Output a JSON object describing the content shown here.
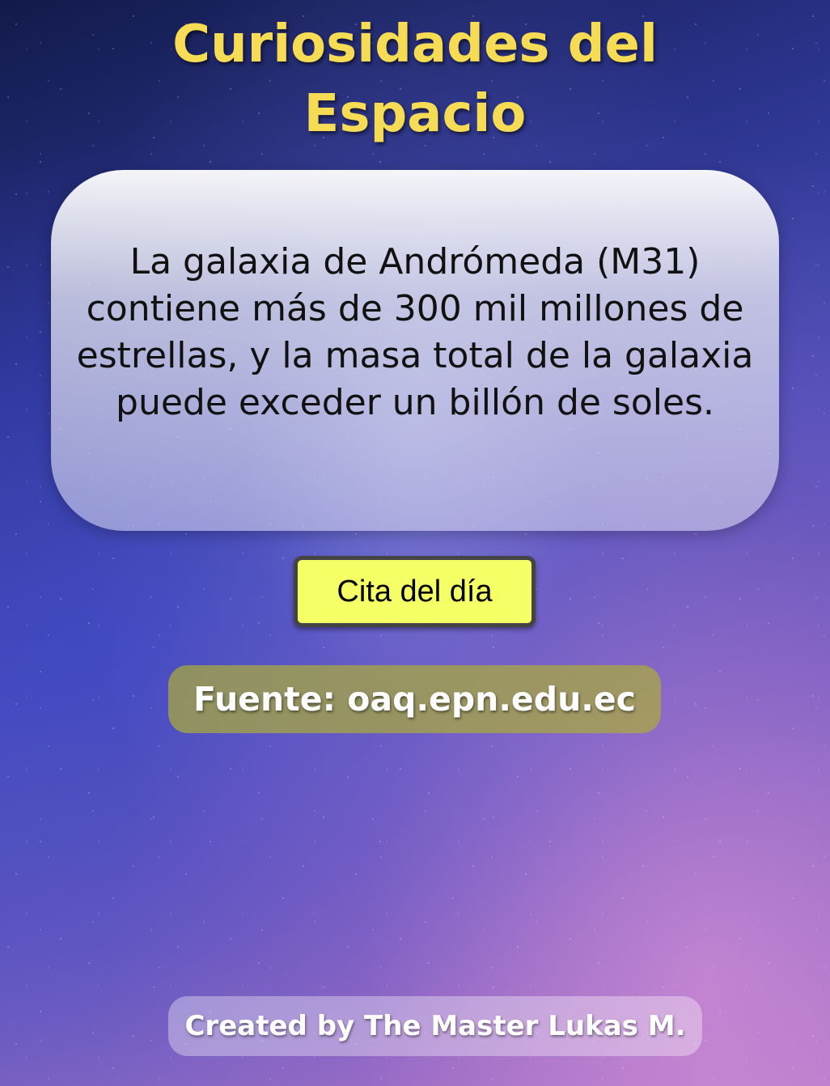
{
  "header": {
    "title_line1": "Curiosidades del",
    "title_line2": "Espacio"
  },
  "fact": {
    "text": "La galaxia de Andrómeda (M31) contiene más de 300 mil millones de estrellas, y la masa total de la galaxia puede exceder un billón de soles."
  },
  "actions": {
    "quote_button_label": "Cita del día"
  },
  "source": {
    "label": "Fuente: oaq.epn.edu.ec"
  },
  "footer": {
    "credit": "Created by The Master Lukas M."
  },
  "colors": {
    "title": "#f6dc55",
    "button_bg": "#f5ff66",
    "source_bg": "#aaaa3c"
  }
}
